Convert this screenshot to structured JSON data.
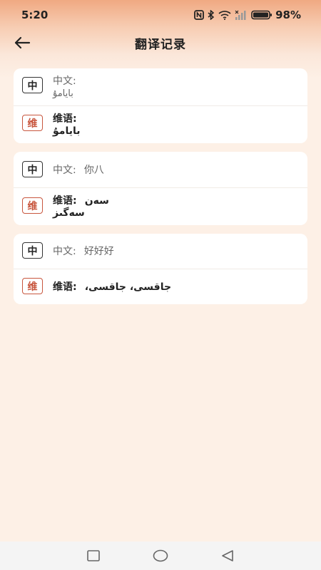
{
  "status": {
    "time": "5:20",
    "battery": "98%",
    "icons": [
      "nfc-icon",
      "bluetooth-icon",
      "wifi-icon",
      "signal-icon",
      "battery-icon"
    ]
  },
  "header": {
    "title": "翻译记录",
    "back_icon": "arrow-left-icon"
  },
  "records": [
    {
      "zh_badge": "中",
      "zh_label": "中文:",
      "zh_text": "بايامۇ",
      "zh_inline": false,
      "ug_badge": "维",
      "ug_label": "维语:",
      "ug_text": "بايامۇ",
      "ug_inline": false
    },
    {
      "zh_badge": "中",
      "zh_label": "中文:",
      "zh_text": "你八",
      "ug_badge": "维",
      "ug_label": "维语:",
      "ug_text_1": "سەن",
      "ug_text_2": "سەگىز"
    },
    {
      "zh_badge": "中",
      "zh_label": "中文:",
      "zh_text": "好好好",
      "ug_badge": "维",
      "ug_label": "维语:",
      "ug_text": "،جاقسى، جاقسى"
    }
  ],
  "nav": {
    "recents_icon": "square-icon",
    "home_icon": "circle-icon",
    "back_icon": "triangle-back-icon"
  },
  "colors": {
    "accent": "#c8563e",
    "background": "#fdf0e6",
    "header_top": "#f0a982"
  }
}
